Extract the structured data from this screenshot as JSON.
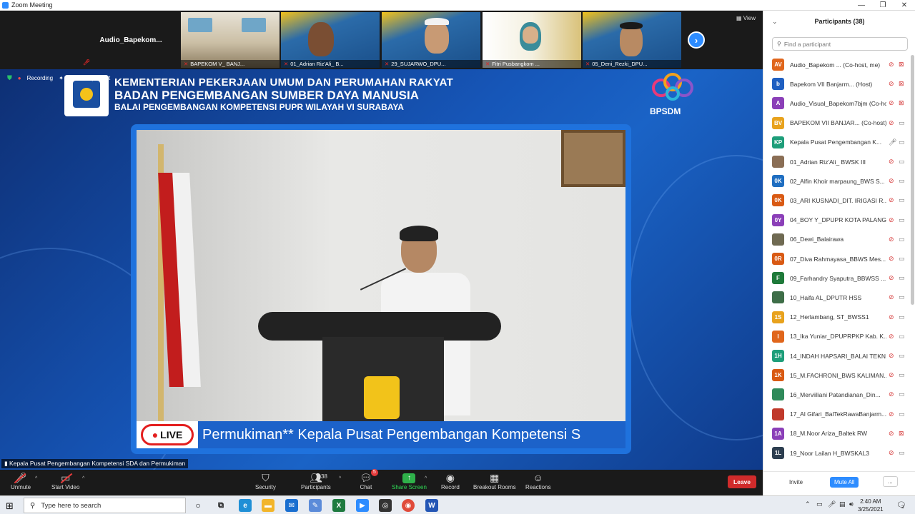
{
  "window": {
    "title": "Zoom Meeting"
  },
  "video_strip": {
    "audio_tile_name": "Audio_Bapekom...",
    "view_label": "View",
    "thumbnails": [
      {
        "name": "BAPEKOM V_ BANJ...",
        "color": "#b7a78c"
      },
      {
        "name": "01_Adrian Riz'Ali_ B...",
        "color": "#2b6ba9"
      },
      {
        "name": "29_SUJARWO_DPU...",
        "color": "#2b6ba9"
      },
      {
        "name": "Fitri Pusbangkom ...",
        "color": "#d7c77a"
      },
      {
        "name": "05_Deni_Rezki_DPU...",
        "color": "#2b6ba9"
      }
    ]
  },
  "main_video": {
    "recording_label": "Recording",
    "remove_spotlight_label": "Remove Spotlight",
    "header_line1": "KEMENTERIAN PEKERJAAN UMUM DAN PERUMAHAN RAKYAT",
    "header_line2": "BADAN PENGEMBANGAN SUMBER DAYA MANUSIA",
    "header_line3": "BALAI PENGEMBANGAN KOMPETENSI PUPR WILAYAH VI SURABAYA",
    "bpsdm_label": "BPSDM",
    "live_label": "LIVE",
    "ticker_text": "Permukiman** Kepala Pusat Pengembangan Kompetensi S",
    "active_speaker": "Kepala Pusat Pengembangan Kompetensi SDA dan Permukiman"
  },
  "toolbar": {
    "unmute": "Unmute",
    "start_video": "Start Video",
    "security": "Security",
    "participants": "Participants",
    "participants_count": "38",
    "chat": "Chat",
    "chat_badge": "5",
    "share_screen": "Share Screen",
    "record": "Record",
    "breakout_rooms": "Breakout Rooms",
    "reactions": "Reactions",
    "leave": "Leave"
  },
  "participants_panel": {
    "title": "Participants (38)",
    "search_placeholder": "Find a participant",
    "invite": "Invite",
    "mute_all": "Mute All",
    "more": "...",
    "items": [
      {
        "initials": "AV",
        "name": "Audio_Bapekom ... (Co-host, me)",
        "color": "#e0661c",
        "mic": "muted",
        "cam": "off"
      },
      {
        "initials": "b",
        "name": "Bapekom VII Banjarm... (Host)",
        "color": "#1f5fc1",
        "mic": "muted",
        "cam": "off"
      },
      {
        "initials": "A",
        "name": "Audio_Visual_Bapekom7bjm (Co-host)",
        "color": "#8b3fb8",
        "mic": "muted",
        "cam": "off"
      },
      {
        "initials": "BV",
        "name": "BAPEKOM VII BANJAR... (Co-host)",
        "color": "#e8a21d",
        "mic": "muted",
        "cam": "on"
      },
      {
        "initials": "KP",
        "name": "Kepala Pusat Pengembangan K...",
        "color": "#1e9e7a",
        "mic": "on",
        "cam": "on"
      },
      {
        "initials": "",
        "name": "01_Adrian Riz'Ali_ BWSK III",
        "color": "#8a6e55",
        "mic": "muted",
        "cam": "on"
      },
      {
        "initials": "0K",
        "name": "02_Alfin Khoir marpaung_BWS S...",
        "color": "#1f6ec1",
        "mic": "muted",
        "cam": "on"
      },
      {
        "initials": "0K",
        "name": "03_ARI KUSNADI_DIT. IRIGASI R...",
        "color": "#d95a14",
        "mic": "muted",
        "cam": "on"
      },
      {
        "initials": "0Y",
        "name": "04_BOY Y_DPUPR KOTA PALANG...",
        "color": "#8b3fb8",
        "mic": "muted",
        "cam": "on"
      },
      {
        "initials": "",
        "name": "06_Dewi_Balairawa",
        "color": "#6f6a52",
        "mic": "muted",
        "cam": "on"
      },
      {
        "initials": "0R",
        "name": "07_Diva Rahmayasa_BBWS Mes...",
        "color": "#d95a14",
        "mic": "muted",
        "cam": "on"
      },
      {
        "initials": "F",
        "name": "09_Farhandry Syaputra_BBWSS ...",
        "color": "#1f7a3a",
        "mic": "muted",
        "cam": "on"
      },
      {
        "initials": "",
        "name": "10_Haifa AL_DPUTR HSS",
        "color": "#3e6e48",
        "mic": "muted",
        "cam": "on"
      },
      {
        "initials": "1S",
        "name": "12_Herlambang, ST_BWSS1",
        "color": "#e8a21d",
        "mic": "muted",
        "cam": "on"
      },
      {
        "initials": "I",
        "name": "13_Ika Yuniar_DPUPRPKP Kab. K...",
        "color": "#e0661c",
        "mic": "muted",
        "cam": "on"
      },
      {
        "initials": "1H",
        "name": "14_INDAH HAPSARI_BALAI TEKN...",
        "color": "#1e9e7a",
        "mic": "muted",
        "cam": "on"
      },
      {
        "initials": "1K",
        "name": "15_M.FACHRONI_BWS KALIMAN...",
        "color": "#d95a14",
        "mic": "muted",
        "cam": "on"
      },
      {
        "initials": "",
        "name": "16_Merviiliani Patandianan_Din...",
        "color": "#2f8a5a",
        "mic": "muted",
        "cam": "on"
      },
      {
        "initials": "",
        "name": "17_Al Gifari_BalTekRawaBanjarm...",
        "color": "#c0392b",
        "mic": "muted",
        "cam": "on"
      },
      {
        "initials": "1A",
        "name": "18_M.Noor Ariza_Baltek RW",
        "color": "#8b3fb8",
        "mic": "muted",
        "cam": "off"
      },
      {
        "initials": "1L",
        "name": "19_Noor Lailan H_BWSKAL3",
        "color": "#2d3e50",
        "mic": "muted",
        "cam": "on"
      }
    ]
  },
  "taskbar": {
    "search_placeholder": "Type here to search",
    "time": "2:40 AM",
    "date": "3/25/2021",
    "notification_count": "2"
  }
}
